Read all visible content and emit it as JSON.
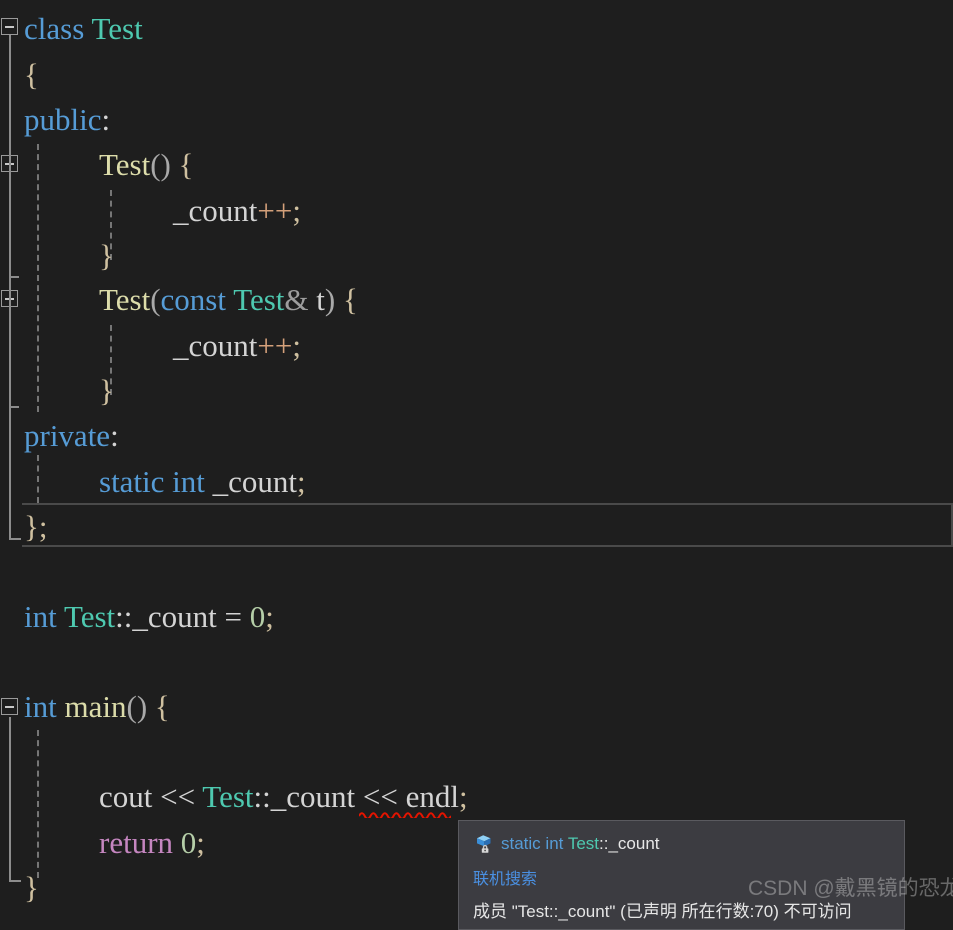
{
  "editor": {
    "theme": "visual-studio-dark",
    "background_color": "#1e1e1e",
    "default_text_color": "#d4d4d4",
    "language": "cpp",
    "current_line_text": "};",
    "lines": [
      {
        "n": 1,
        "indent": 0,
        "text": "class Test"
      },
      {
        "n": 2,
        "indent": 0,
        "text": "{"
      },
      {
        "n": 3,
        "indent": 0,
        "text": "public:"
      },
      {
        "n": 4,
        "indent": 1,
        "text": "Test() {"
      },
      {
        "n": 5,
        "indent": 2,
        "text": "_count++;"
      },
      {
        "n": 6,
        "indent": 1,
        "text": "}"
      },
      {
        "n": 7,
        "indent": 1,
        "text": "Test(const Test& t) {"
      },
      {
        "n": 8,
        "indent": 2,
        "text": "_count++;"
      },
      {
        "n": 9,
        "indent": 1,
        "text": "}"
      },
      {
        "n": 10,
        "indent": 0,
        "text": "private:"
      },
      {
        "n": 11,
        "indent": 1,
        "text": "static int _count;"
      },
      {
        "n": 12,
        "indent": 0,
        "text": "};"
      },
      {
        "n": 13,
        "indent": 0,
        "text": ""
      },
      {
        "n": 14,
        "indent": 0,
        "text": "int Test::_count = 0;"
      },
      {
        "n": 15,
        "indent": 0,
        "text": ""
      },
      {
        "n": 16,
        "indent": 0,
        "text": "int main() {"
      },
      {
        "n": 17,
        "indent": 0,
        "text": ""
      },
      {
        "n": 18,
        "indent": 1,
        "text": "cout << Test::_count << endl;"
      },
      {
        "n": 19,
        "indent": 1,
        "text": "return 0;"
      },
      {
        "n": 20,
        "indent": 0,
        "text": "}"
      }
    ],
    "tokens": {
      "kw_class": "class",
      "kw_public": "public",
      "kw_private": "private",
      "kw_const": "const",
      "kw_static": "static",
      "kw_int": "int",
      "kw_return": "return",
      "type_test": "Test",
      "ident_count": "_count",
      "ident_t": "t",
      "ident_cout": "cout",
      "ident_endl": "endl",
      "ident_main": "main",
      "op_inc": "++",
      "op_shift": "<<",
      "op_assign": "=",
      "op_amp": "&",
      "op_scope": "::",
      "num_zero": "0",
      "brace_open": "{",
      "brace_close": "}",
      "paren_open": "(",
      "paren_close": ")",
      "semicolon": ";",
      "colon": ":",
      "class_end": "};"
    },
    "colors": {
      "keyword": "#569cd6",
      "type": "#4ec9b0",
      "function": "#dcdcaa",
      "identifier": "#d4d4d4",
      "number": "#b5cea8",
      "control": "#c586c0",
      "brace": "#cfc0a0",
      "operator": "#d4a07a",
      "error_squiggle": "#e51400",
      "indent_guide": "#767676",
      "fold_marker": "#9a9a9a",
      "current_line_border": "#4a4a4a"
    },
    "error_marker": {
      "type": "red-squiggly-underline",
      "underlined_token": "_count",
      "on_line": 18
    },
    "fold_markers": [
      {
        "name": "fold-class-test",
        "line": 1,
        "state": "expanded",
        "glyph": "minus"
      },
      {
        "name": "fold-ctor-default",
        "line": 4,
        "state": "expanded",
        "glyph": "minus"
      },
      {
        "name": "fold-ctor-copy",
        "line": 7,
        "state": "expanded",
        "glyph": "minus"
      },
      {
        "name": "fold-main",
        "line": 16,
        "state": "expanded",
        "glyph": "minus"
      }
    ]
  },
  "tooltip": {
    "name": "quick-info-tooltip",
    "icon": "field-private-icon",
    "icon_description": "blue box with lock overlay",
    "signature_static": "static",
    "signature_int": "int",
    "signature_type": "Test",
    "signature_scope": "::",
    "signature_member": "_count",
    "signature_full": "static int Test::_count",
    "link_label": "联机搜索",
    "message": "成员 \"Test::_count\" (已声明 所在行数:70) 不可访问",
    "background_color": "#3c3c41",
    "border_color": "#5a5a5f",
    "link_color": "#4a90e2"
  },
  "watermark": {
    "text": "CSDN @戴黑镜的恐龙"
  }
}
